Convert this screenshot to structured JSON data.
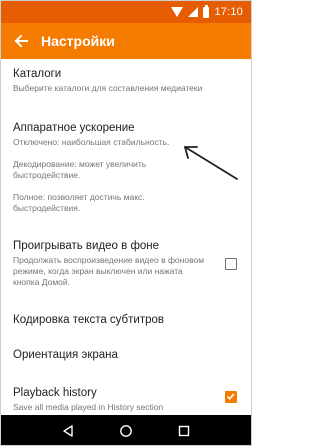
{
  "status_bar": {
    "time": "17:10",
    "icons": [
      "wifi-icon",
      "signal-icon",
      "battery-icon"
    ],
    "color": "#e65c00"
  },
  "app_bar": {
    "title": "Настройки",
    "back_icon": "arrow-left-icon",
    "color": "#f57c00"
  },
  "settings": {
    "catalogs": {
      "title": "Каталоги",
      "summary": "Выберите каталоги для составления медиатеки"
    },
    "hw_accel": {
      "title": "Аппаратное ускорение",
      "summary_1": "Отключено: наибольшая стабильность.",
      "summary_2": "Декодирование: может увеличить быстродействие.",
      "summary_3": "Полное: позволяет достичь макс. быстродействия."
    },
    "background_play": {
      "title": "Проигрывать видео в фоне",
      "summary": "Продолжать воспроизведение видео в фоновом режиме, когда экран выключен или нажата кнопка Домой.",
      "checked": false
    },
    "subtitle_encoding": {
      "title": "Кодировка текста субтитров"
    },
    "orientation": {
      "title": "Ориентация экрана"
    },
    "playback_history": {
      "title": "Playback history",
      "summary": "Save all media played in History section",
      "checked": true
    }
  },
  "accent_color": "#f57c00",
  "nav_bar": {
    "icons": [
      "back-triangle-icon",
      "home-circle-icon",
      "recents-square-icon"
    ]
  }
}
